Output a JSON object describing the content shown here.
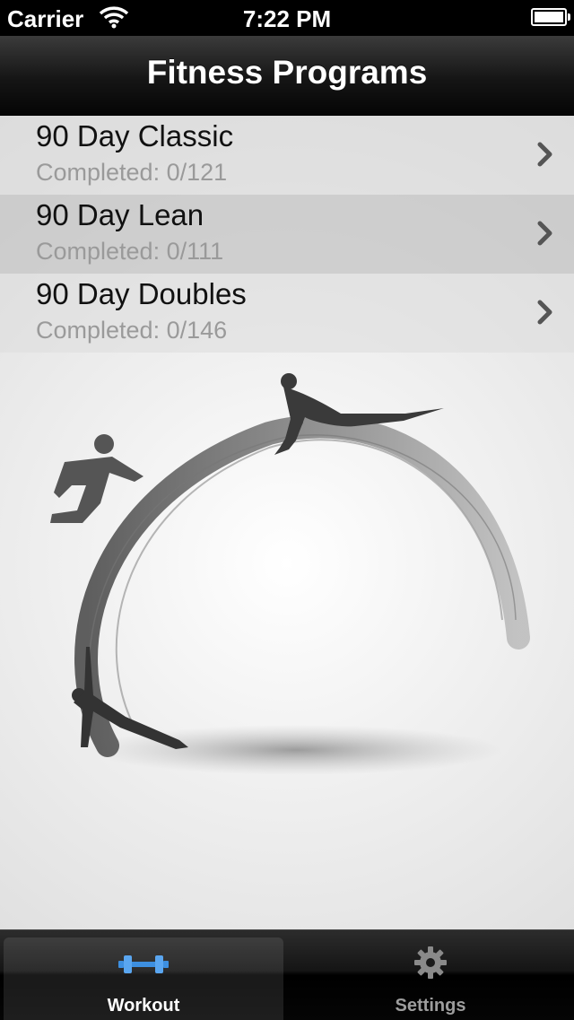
{
  "status_bar": {
    "carrier": "Carrier",
    "time": "7:22 PM",
    "wifi_icon": "wifi-icon",
    "battery_icon": "battery-icon"
  },
  "nav": {
    "title": "Fitness Programs"
  },
  "programs": [
    {
      "name": "90 Day Classic",
      "progress": "Completed: 0/121",
      "selected": false
    },
    {
      "name": "90 Day Lean",
      "progress": "Completed: 0/111",
      "selected": true
    },
    {
      "name": "90 Day Doubles",
      "progress": "Completed: 0/146",
      "selected": false
    }
  ],
  "tabs": [
    {
      "label": "Workout",
      "icon": "dumbbell-icon",
      "active": true
    },
    {
      "label": "Settings",
      "icon": "gear-icon",
      "active": false
    }
  ],
  "colors": {
    "accent": "#3d8fe0",
    "nav_bg": "#111111",
    "subtitle": "#9a9a9a"
  }
}
